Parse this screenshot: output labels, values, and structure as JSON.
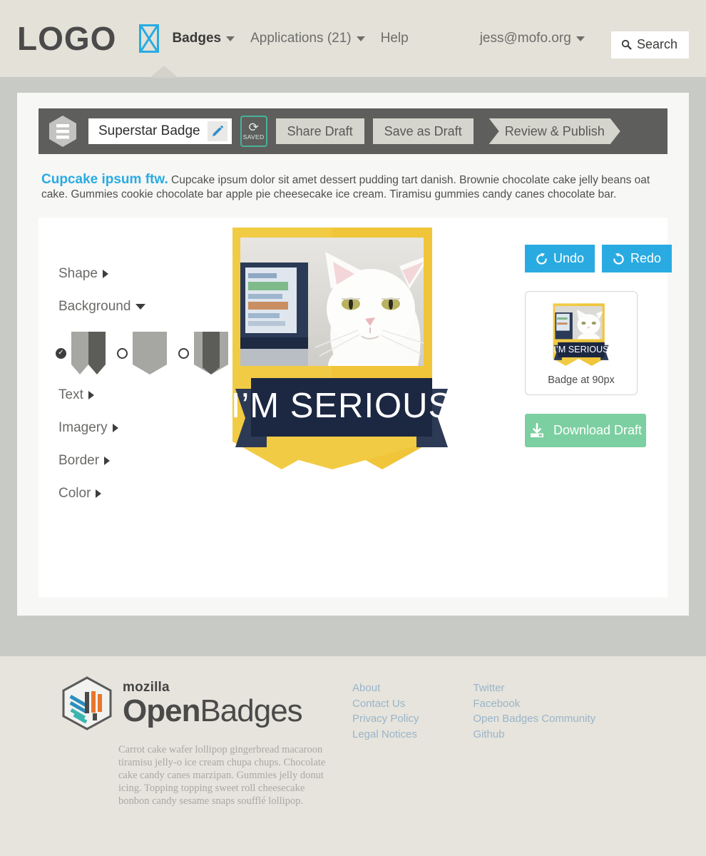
{
  "nav": {
    "logo": "LOGO",
    "placeholder_icon": "image-placeholder-icon",
    "items": [
      {
        "label": "Badges",
        "caret": true
      },
      {
        "label": "Applications (21)",
        "caret": true
      },
      {
        "label": "Help",
        "caret": false
      }
    ],
    "user": {
      "label": "jess@mofo.org",
      "caret": true
    },
    "search": {
      "label": "Search",
      "icon": "search-icon"
    }
  },
  "toolbar": {
    "menu_icon": "hamburger-hex-icon",
    "badge_title": "Superstar Badge",
    "edit_icon": "pencil-icon",
    "saved": {
      "icon": "refresh-icon",
      "label": "SAVED"
    },
    "share_label": "Share Draft",
    "save_label": "Save as Draft",
    "publish_label": "Review & Publish"
  },
  "description": {
    "lead": "Cupcake ipsum ftw.",
    "body": "Cupcake ipsum dolor sit amet dessert pudding tart danish. Brownie chocolate cake jelly beans oat cake. Gummies cookie chocolate bar apple pie cheesecake ice cream. Tiramisu gummies candy canes chocolate bar."
  },
  "sidebar": {
    "items": [
      {
        "label": "Shape",
        "state": "collapsed"
      },
      {
        "label": "Background",
        "state": "expanded"
      },
      {
        "label": "Text",
        "state": "collapsed"
      },
      {
        "label": "Imagery",
        "state": "collapsed"
      },
      {
        "label": "Border",
        "state": "collapsed"
      },
      {
        "label": "Color",
        "state": "collapsed"
      }
    ],
    "background_options": [
      {
        "name": "shield-split-shape",
        "selected": true
      },
      {
        "name": "shield-flat-shape",
        "selected": false
      },
      {
        "name": "shield-band-shape",
        "selected": false
      }
    ]
  },
  "badge": {
    "ribbon_text": "I’M SERIOUS",
    "shield_color": "#f2cb44",
    "ribbon_color": "#1c2742",
    "ribbon_tail_color": "#2d3a55",
    "photo_alt": "white-cat-photo"
  },
  "rail": {
    "undo": {
      "label": "Undo",
      "icon": "undo-icon"
    },
    "redo": {
      "label": "Redo",
      "icon": "redo-icon"
    },
    "preview_label": "Badge at 90px",
    "download": {
      "label": "Download Draft",
      "icon": "download-icon"
    }
  },
  "footer": {
    "brand_small": "mozilla",
    "brand_bold": "Open",
    "brand_light": "Badges",
    "logo_icon": "open-badges-hex-logo",
    "blurb": "Carrot cake wafer lollipop gingerbread macaroon tiramisu jelly-o ice cream chupa chups. Chocolate cake candy canes marzipan. Gummies jelly donut icing. Topping topping sweet roll cheesecake bonbon candy sesame snaps soufflé lollipop.",
    "links_col1": [
      "About",
      "Contact Us",
      "Privacy Policy",
      "Legal Notices"
    ],
    "links_col2": [
      "Twitter",
      "Facebook",
      "Open Badges Community",
      "Github"
    ]
  },
  "colors": {
    "accent_blue": "#29abe2",
    "green": "#7ccfa0",
    "saved_green": "#46b39a",
    "page_bg": "#e6e4dc",
    "gray_band": "#c8cac6",
    "toolbar": "#5e5e5c"
  }
}
